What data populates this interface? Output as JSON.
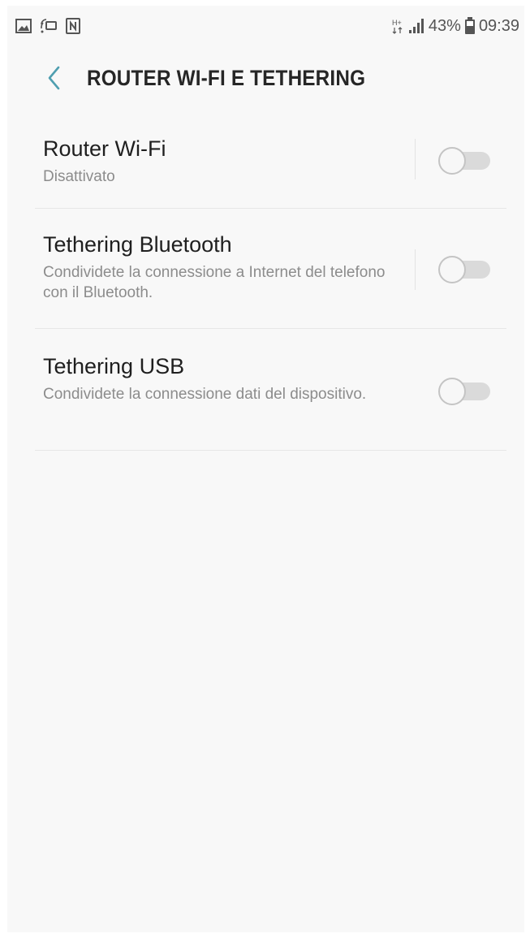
{
  "status_bar": {
    "left_icons": [
      "image-icon",
      "screen-mirroring-icon",
      "nfc-icon"
    ],
    "network_type": "H+",
    "battery_percent": "43%",
    "time": "09:39"
  },
  "header": {
    "back_icon": "chevron-left-icon",
    "title": "ROUTER WI-FI E TETHERING"
  },
  "settings": [
    {
      "title": "Router Wi-Fi",
      "description": "Disattivato",
      "enabled": false,
      "has_divider": true
    },
    {
      "title": "Tethering Bluetooth",
      "description": "Condividete la connessione a Internet del telefono con il Bluetooth.",
      "enabled": false,
      "has_divider": true
    },
    {
      "title": "Tethering USB",
      "description": "Condividete la connessione dati del dispositivo.",
      "enabled": false,
      "has_divider": false
    }
  ],
  "colors": {
    "accent": "#4f9fb0",
    "background": "#f8f8f8",
    "toggle_off_track": "#dadada"
  }
}
